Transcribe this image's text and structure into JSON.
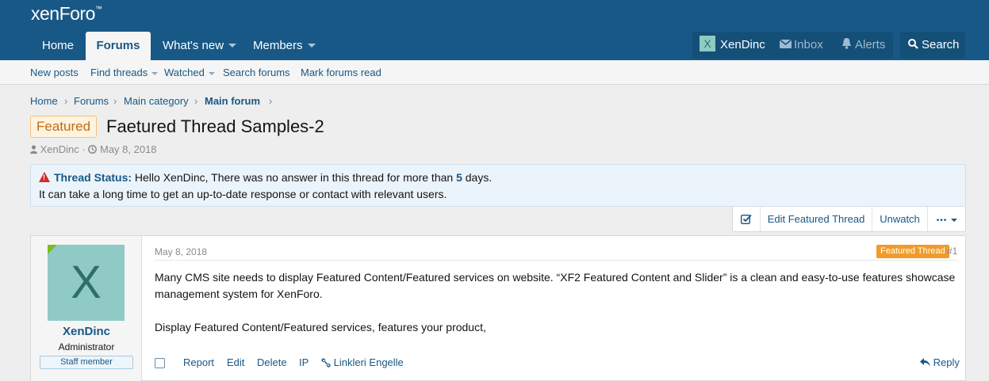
{
  "brand": {
    "logo": "xenForo",
    "logo_mark": "™"
  },
  "nav": {
    "tabs": [
      {
        "label": "Home"
      },
      {
        "label": "Forums"
      },
      {
        "label": "What's new"
      },
      {
        "label": "Members"
      }
    ]
  },
  "user_bar": {
    "avatar_letter": "X",
    "username": "XenDinc",
    "inbox": "Inbox",
    "alerts": "Alerts",
    "search": "Search"
  },
  "subnav": {
    "items": [
      {
        "label": "New posts"
      },
      {
        "label": "Find threads"
      },
      {
        "label": "Watched"
      },
      {
        "label": "Search forums"
      },
      {
        "label": "Mark forums read"
      }
    ]
  },
  "breadcrumb": [
    "Home",
    "Forums",
    "Main category",
    "Main forum"
  ],
  "thread": {
    "prefix": "Featured",
    "title": "Faetured Thread Samples-2",
    "author": "XenDinc",
    "date": "May 8, 2018",
    "meta_separator": "·"
  },
  "status_notice": {
    "label": "Thread Status:",
    "text_before": "Hello XenDinc, There was no answer in this thread for more than",
    "days": "5",
    "text_after": "days.",
    "line2": "It can take a long time to get an up-to-date response or contact with relevant users."
  },
  "thread_actions": {
    "edit_featured": "Edit Featured Thread",
    "unwatch": "Unwatch",
    "more": "•••"
  },
  "post": {
    "avatar_letter": "X",
    "username": "XenDinc",
    "role": "Administrator",
    "badge": "Staff member",
    "date": "May 8, 2018",
    "featured_badge": "Featured Thread",
    "number": "#1",
    "paragraph1": "Many CMS site needs to display Featured Content/Featured services on website. “XF2 Featured Content and Slider” is a clean and easy-to-use features showcase management system for XenForo.",
    "paragraph2": "Display Featured Content/Featured services, features your product,",
    "actions": {
      "report": "Report",
      "edit": "Edit",
      "delete": "Delete",
      "ip": "IP",
      "links": "Linkleri Engelle",
      "reply": "Reply"
    }
  }
}
